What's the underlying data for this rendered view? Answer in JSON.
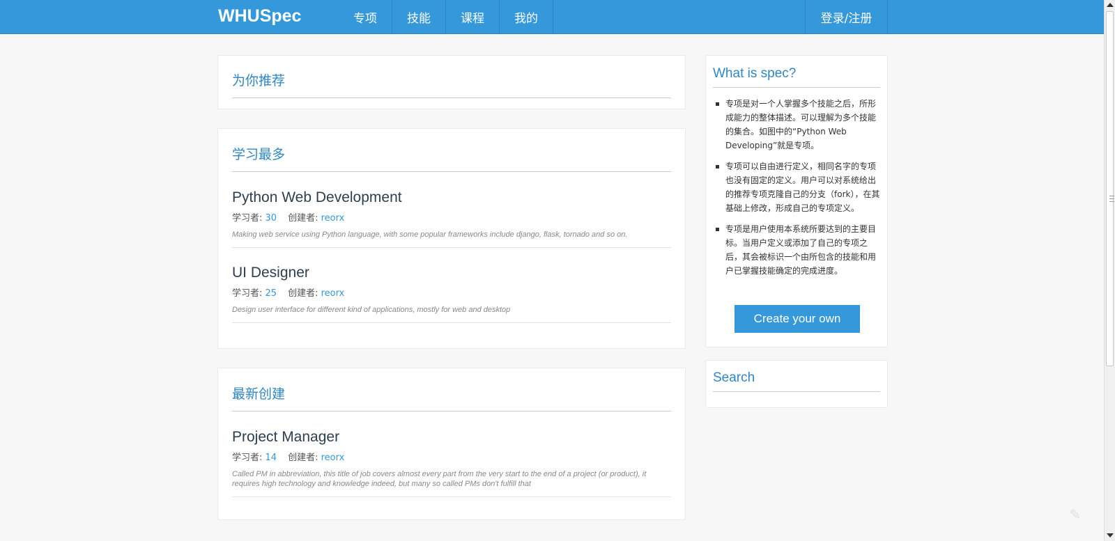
{
  "navbar": {
    "brand": "WHUSpec",
    "items": [
      {
        "label": "专项"
      },
      {
        "label": "技能"
      },
      {
        "label": "课程"
      },
      {
        "label": "我的"
      }
    ],
    "login": "登录/注册"
  },
  "recommend": {
    "title": "为你推荐"
  },
  "most_learned": {
    "title": "学习最多",
    "items": [
      {
        "title": "Python Web Development",
        "learners_label": "学习者: ",
        "learners": "30",
        "creator_label": "创建者: ",
        "creator": "reorx",
        "desc": "Making web service using Python language, with some popular frameworks include django, flask, tornado and so on."
      },
      {
        "title": "UI Designer",
        "learners_label": "学习者: ",
        "learners": "25",
        "creator_label": "创建者: ",
        "creator": "reorx",
        "desc": "Design user interface for different kind of applications, mostly for web and desktop"
      }
    ]
  },
  "newest": {
    "title": "最新创建",
    "items": [
      {
        "title": "Project Manager",
        "learners_label": "学习者: ",
        "learners": "14",
        "creator_label": "创建者: ",
        "creator": "reorx",
        "desc": "Called PM in abbreviation, this title of job covers almost every part from the very start to the end of a project (or product), it requires high technology and knowledge indeed, but many so called PMs don't fulfill that"
      }
    ]
  },
  "sidebar": {
    "what_title": "What is spec?",
    "points": [
      "专项是对一个人掌握多个技能之后，所形成能力的整体描述。可以理解为多个技能的集合。如图中的“Python Web Developing”就是专项。",
      "专项可以自由进行定义，相同名字的专项也没有固定的定义。用户可以对系统给出的推荐专项克隆自己的分支（fork），在其基础上修改，形成自己的专项定义。",
      "专项是用户使用本系统所要达到的主要目标。当用户定义或添加了自己的专项之后，其会被标识一个由所包含的技能和用户已掌握技能确定的完成进度。"
    ],
    "create_button": "Create your own",
    "search_title": "Search"
  },
  "colors": {
    "navbar": "#3498db",
    "accent": "#2f86c5",
    "link": "#3498db"
  },
  "icons": {
    "feedback": "pencil-icon"
  }
}
